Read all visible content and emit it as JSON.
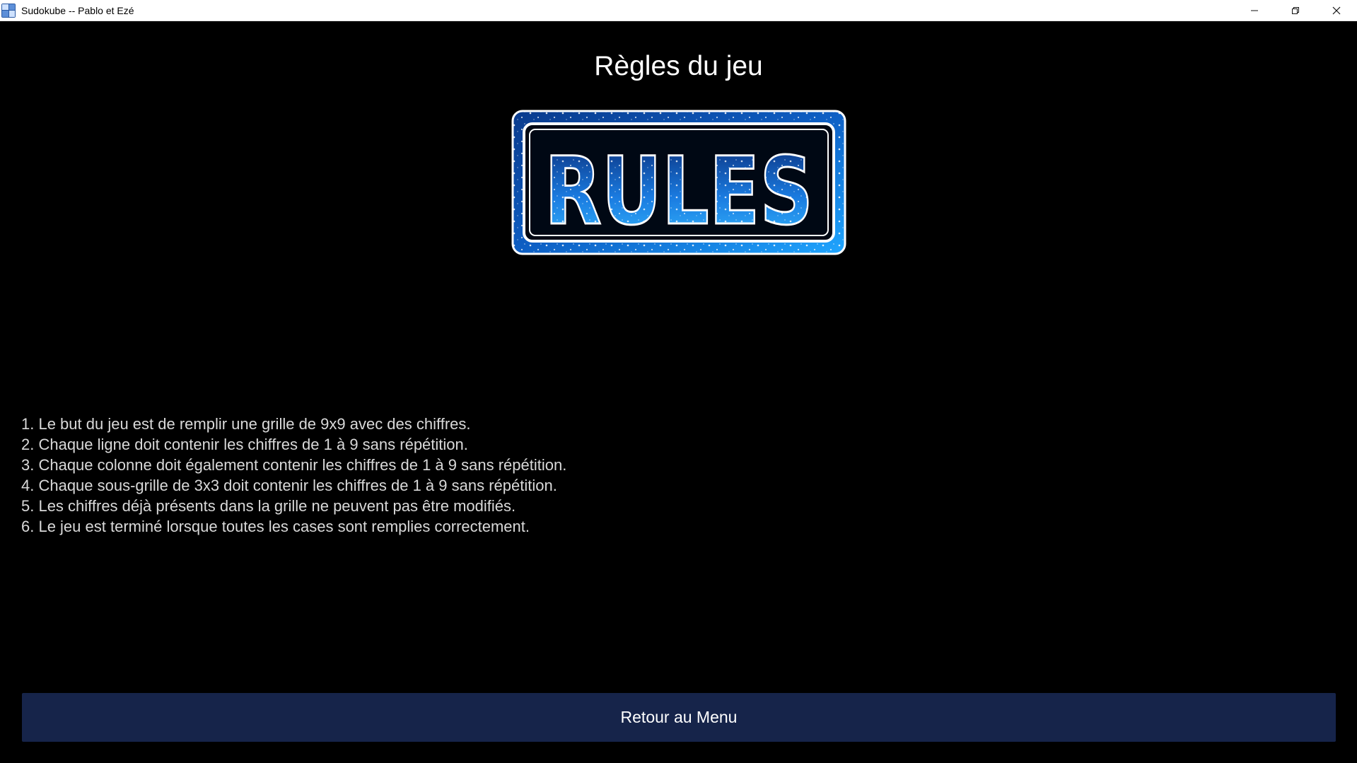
{
  "window": {
    "title": "Sudokube -- Pablo et Ezé",
    "icons": {
      "app": "sudoku-grid-icon",
      "minimize": "minimize-icon",
      "restore": "restore-icon",
      "close": "close-icon"
    }
  },
  "page": {
    "title": "Règles du jeu",
    "banner_text": "RULES",
    "rules": [
      "1. Le but du jeu est de remplir une grille de 9x9 avec des chiffres.",
      "2. Chaque ligne doit contenir les chiffres de 1 à 9 sans répétition.",
      "3. Chaque colonne doit également contenir les chiffres de 1 à 9 sans répétition.",
      "4. Chaque sous-grille de 3x3 doit contenir les chiffres de 1 à 9 sans répétition.",
      "5. Les chiffres déjà présents dans la grille ne peuvent pas être modifiés.",
      "6. Le jeu est terminé lorsque toutes les cases sont remplies correctement."
    ],
    "back_button_label": "Retour au Menu"
  },
  "colors": {
    "background": "#000000",
    "button_bg": "#16244a",
    "rules_text": "#d9d9d9",
    "banner_blue": "#1e7ad6"
  }
}
